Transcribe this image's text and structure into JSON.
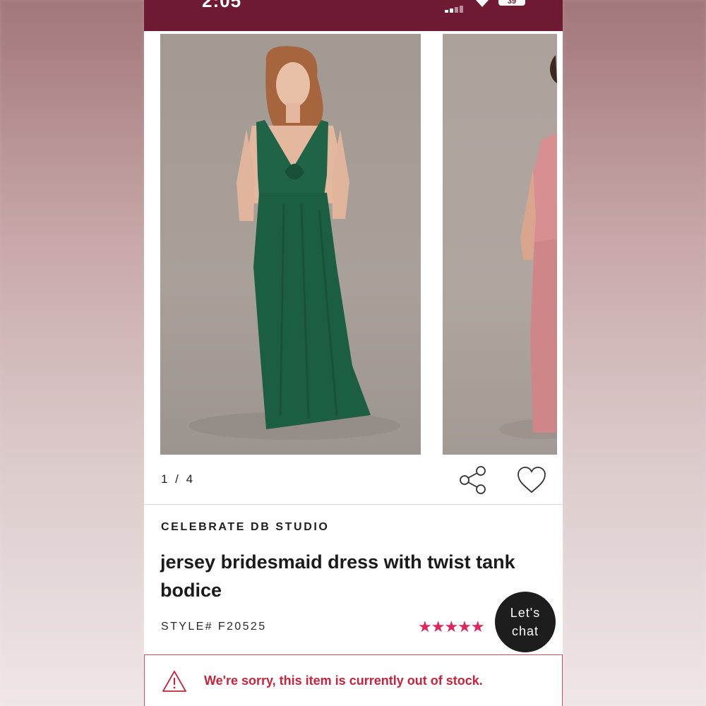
{
  "status_bar": {
    "time": "2:05",
    "battery": "39",
    "background_color": "#6e1a33"
  },
  "gallery": {
    "current_image_text": "1 / 4",
    "main_dress_color": "#1f6447",
    "next_dress_color": "#d88f92"
  },
  "actions": {
    "share_icon": "share-icon",
    "favorite_icon": "heart-outline-icon"
  },
  "product": {
    "brand": "CELEBRATE DB STUDIO",
    "title": "jersey bridesmaid dress with twist tank bodice",
    "style": "STYLE# F20525",
    "rating_stars": "★★★★★",
    "rating_value": 5,
    "star_color": "#e0245e"
  },
  "chat": {
    "line1": "Let's",
    "line2": "chat"
  },
  "alert": {
    "icon": "warning-triangle-icon",
    "message": "We're sorry, this item is currently out of stock.",
    "color": "#c8243b"
  }
}
